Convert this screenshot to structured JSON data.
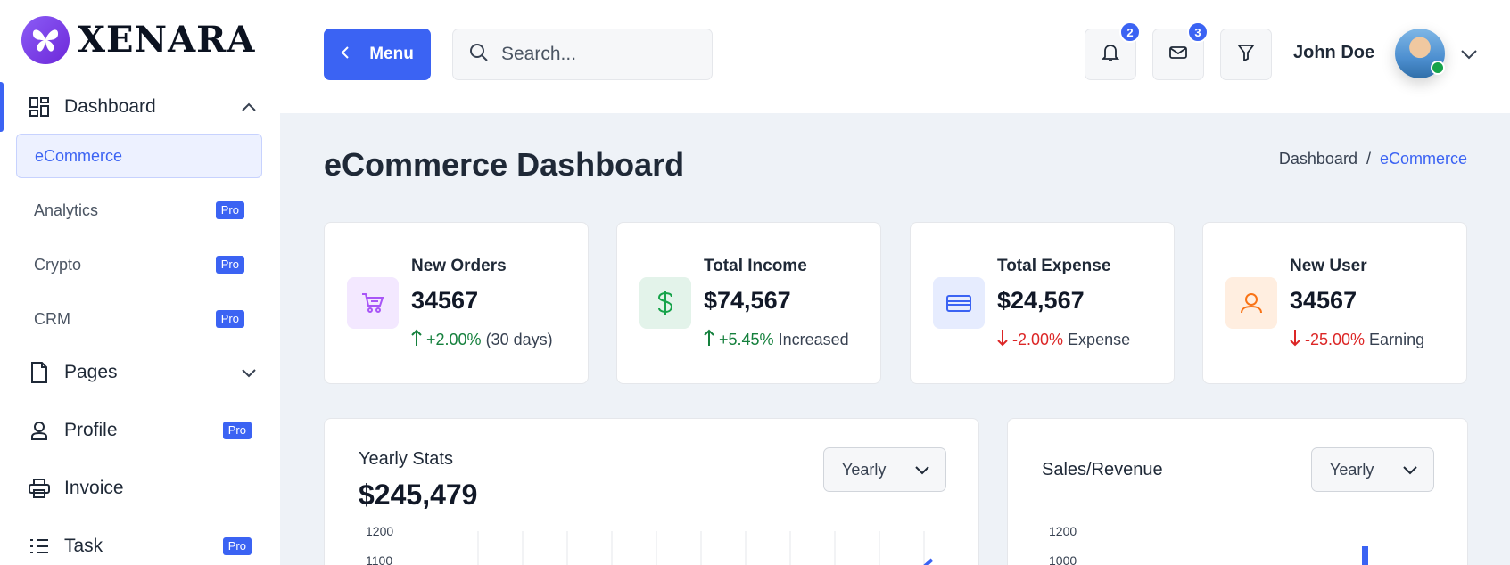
{
  "brand": {
    "name": "XENARA"
  },
  "sidebar": {
    "dashboard": {
      "label": "Dashboard",
      "icon": "dashboard-grid-icon"
    },
    "sub_items": [
      {
        "label": "eCommerce",
        "pro": "",
        "active": true
      },
      {
        "label": "Analytics",
        "pro": "Pro"
      },
      {
        "label": "Crypto",
        "pro": "Pro"
      },
      {
        "label": "CRM",
        "pro": "Pro"
      }
    ],
    "items": [
      {
        "label": "Pages",
        "icon": "file-icon",
        "end": "chevron-down-icon"
      },
      {
        "label": "Profile",
        "icon": "user-icon",
        "pro": "Pro"
      },
      {
        "label": "Invoice",
        "icon": "printer-icon"
      },
      {
        "label": "Task",
        "icon": "list-icon",
        "pro": "Pro"
      }
    ]
  },
  "header": {
    "menu_label": "Menu",
    "search_placeholder": "Search...",
    "notifications_count": "2",
    "messages_count": "3",
    "user_name": "John Doe"
  },
  "page": {
    "title": "eCommerce Dashboard",
    "breadcrumb": [
      "Dashboard",
      "/",
      "eCommerce"
    ]
  },
  "stats": [
    {
      "title": "New Orders",
      "value": "34567",
      "delta": "+2.00%",
      "suffix": "(30 days)",
      "trend": "up",
      "icon": "shopping-cart-icon",
      "color": "#a855f7"
    },
    {
      "title": "Total Income",
      "value": "$74,567",
      "delta": "+5.45%",
      "suffix": "Increased",
      "trend": "up",
      "icon": "dollar-icon",
      "color": "#16a34a"
    },
    {
      "title": "Total Expense",
      "value": "$24,567",
      "delta": "-2.00%",
      "suffix": "Expense",
      "trend": "down",
      "icon": "credit-card-icon",
      "color": "#3b63f3"
    },
    {
      "title": "New User",
      "value": "34567",
      "delta": "-25.00%",
      "suffix": "Earning",
      "trend": "down",
      "icon": "user-icon",
      "color": "#f97316"
    }
  ],
  "yearly_stats": {
    "title": "Yearly Stats",
    "value": "$245,479",
    "select": "Yearly",
    "y_ticks": [
      "1200",
      "1100"
    ]
  },
  "sales_revenue": {
    "title": "Sales/Revenue",
    "select": "Yearly",
    "y_ticks": [
      "1200",
      "1000"
    ]
  }
}
